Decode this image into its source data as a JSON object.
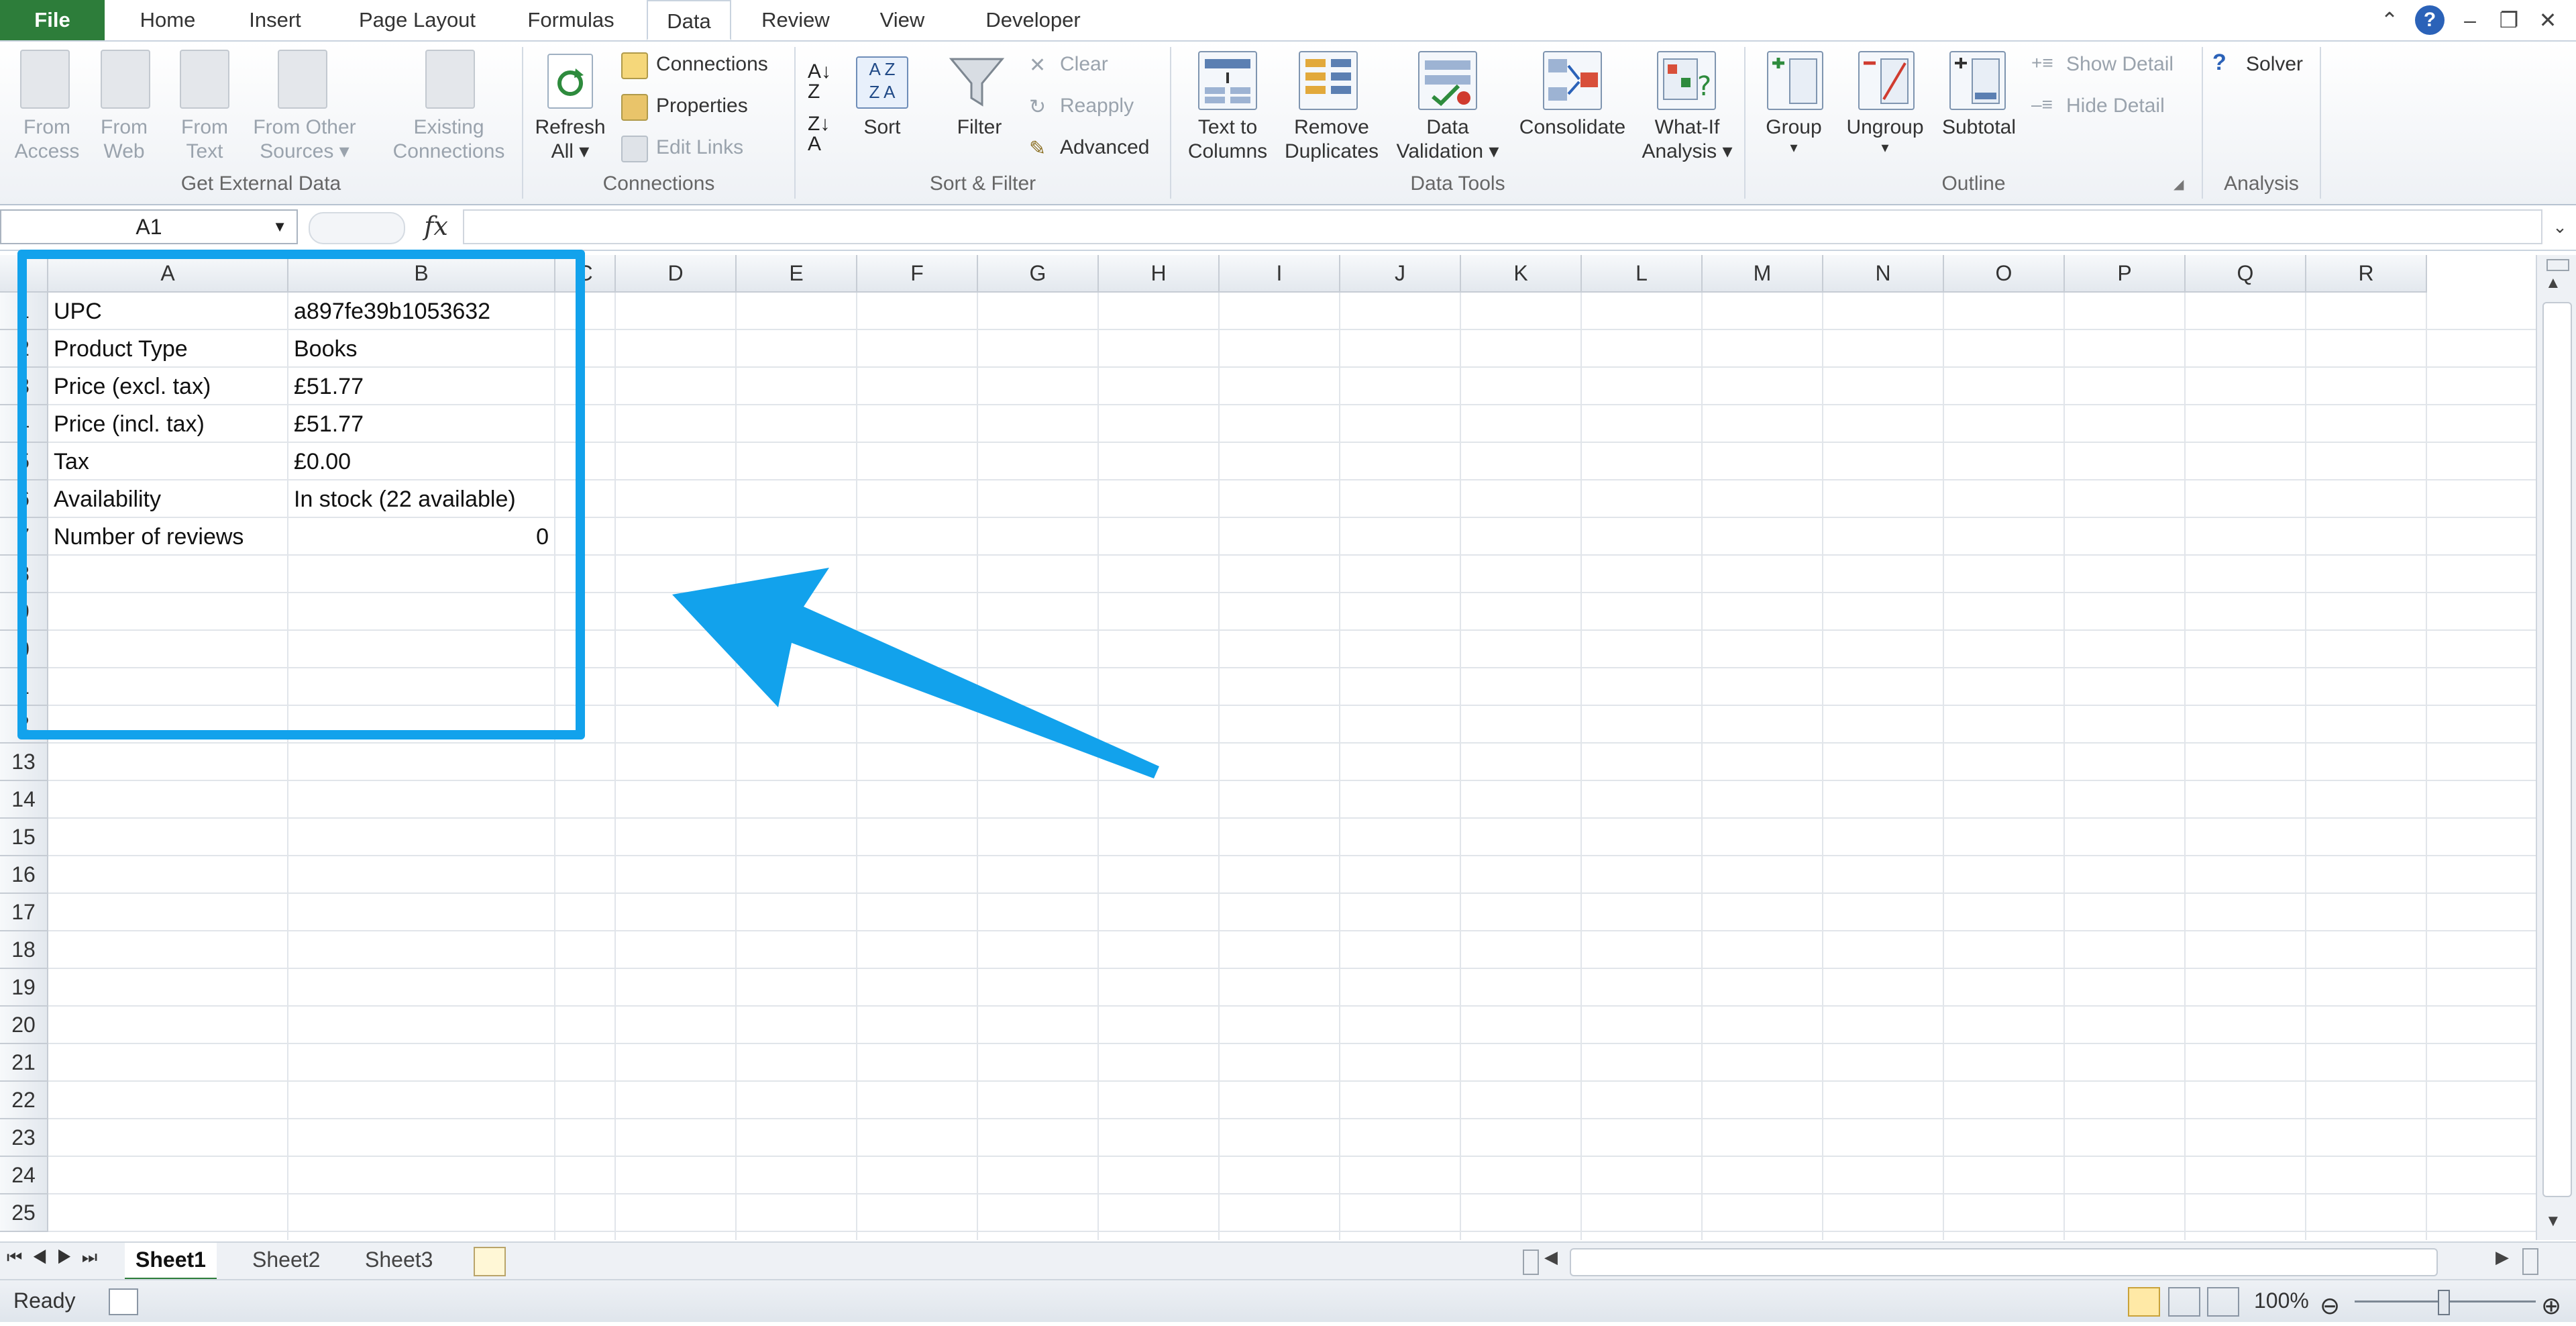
{
  "tabs": [
    {
      "label": "File"
    },
    {
      "label": "Home"
    },
    {
      "label": "Insert"
    },
    {
      "label": "Page Layout"
    },
    {
      "label": "Formulas"
    },
    {
      "label": "Data"
    },
    {
      "label": "Review"
    },
    {
      "label": "View"
    },
    {
      "label": "Developer"
    }
  ],
  "ribbon": {
    "external": {
      "from_access": [
        "From",
        "Access"
      ],
      "from_web": [
        "From",
        "Web"
      ],
      "from_text": [
        "From",
        "Text"
      ],
      "from_other": [
        "From Other",
        "Sources ▾"
      ],
      "existing": [
        "Existing",
        "Connections"
      ],
      "group": "Get External Data"
    },
    "connections": {
      "refresh": [
        "Refresh",
        "All ▾"
      ],
      "items": [
        "Connections",
        "Properties",
        "Edit Links"
      ],
      "group": "Connections"
    },
    "sort": {
      "sort": "Sort",
      "filter": "Filter",
      "clear": "Clear",
      "reapply": "Reapply",
      "advanced": "Advanced",
      "group": "Sort & Filter"
    },
    "tools": {
      "text_to_columns": [
        "Text to",
        "Columns"
      ],
      "remove_duplicates": [
        "Remove",
        "Duplicates"
      ],
      "data_validation": [
        "Data",
        "Validation ▾"
      ],
      "consolidate": "Consolidate",
      "what_if": [
        "What-If",
        "Analysis ▾"
      ],
      "group": "Data Tools"
    },
    "outline": {
      "group_btn": "Group",
      "ungroup_btn": "Ungroup",
      "subtotal": "Subtotal",
      "show_detail": "Show Detail",
      "hide_detail": "Hide Detail",
      "group": "Outline"
    },
    "analysis": {
      "solver": "Solver",
      "group": "Analysis"
    }
  },
  "formula_bar": {
    "name_box": "A1",
    "fx": "fx"
  },
  "columns": [
    "A",
    "B",
    "C",
    "D",
    "E",
    "F",
    "G",
    "H",
    "I",
    "J",
    "K",
    "L",
    "M",
    "N",
    "O",
    "P",
    "Q",
    "R"
  ],
  "rows_visible": [
    "1",
    "2",
    "3",
    "4",
    "5",
    "6",
    "7",
    "8",
    "9",
    "0",
    "1",
    "2",
    "13",
    "14",
    "15",
    "16",
    "17",
    "18",
    "19",
    "20",
    "21",
    "22",
    "23",
    "24",
    "25"
  ],
  "cells": [
    {
      "a": "UPC",
      "b": "a897fe39b1053632"
    },
    {
      "a": "Product Type",
      "b": "Books"
    },
    {
      "a": "Price (excl. tax)",
      "b": "£51.77"
    },
    {
      "a": "Price (incl. tax)",
      "b": "£51.77"
    },
    {
      "a": "Tax",
      "b": "£0.00"
    },
    {
      "a": "Availability",
      "b": "In stock (22 available)"
    },
    {
      "a": "Number of reviews",
      "b": "0"
    }
  ],
  "sheets": [
    "Sheet1",
    "Sheet2",
    "Sheet3"
  ],
  "status": {
    "ready": "Ready",
    "zoom": "100%"
  },
  "colors": {
    "file_tab": "#2d7d3a",
    "annotation": "#12a2ec"
  }
}
